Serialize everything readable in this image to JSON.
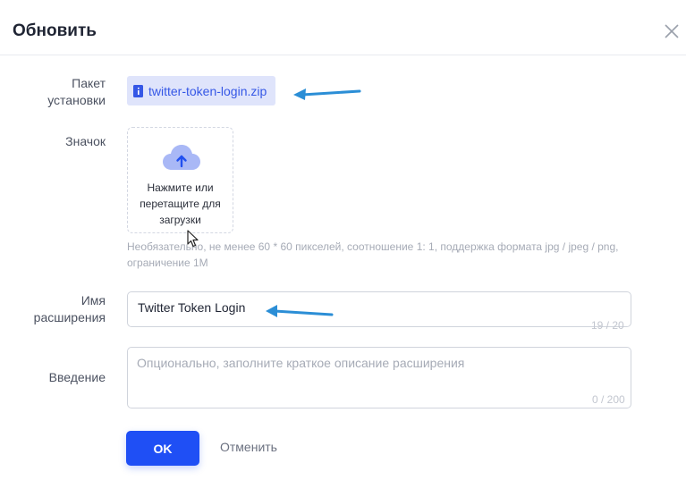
{
  "dialog": {
    "title": "Обновить",
    "close_icon": "close-icon"
  },
  "form": {
    "package_label_line1": "Пакет",
    "package_label_line2": "установки",
    "package_file": "twitter-token-login.zip",
    "icon_label": "Значок",
    "upload_text_line1": "Нажмите или",
    "upload_text_line2": "перетащите для",
    "upload_text_line3": "загрузки",
    "upload_hint_line1": "Необязательно, не менее 60 * 60 пикселей, соотношение 1: 1, поддержка формата jpg / jpeg / png,",
    "upload_hint_line2": "ограничение 1M",
    "name_label_line1": "Имя",
    "name_label_line2": "расширения",
    "name_value": "Twitter Token Login",
    "name_counter": "19 / 20",
    "intro_label": "Введение",
    "intro_placeholder": "Опционально, заполните краткое описание расширения",
    "intro_counter": "0 / 200"
  },
  "buttons": {
    "ok": "OK",
    "cancel": "Отменить"
  },
  "colors": {
    "primary": "#1f4ff5",
    "annotation_arrow": "#2b8ed6",
    "file_chip_bg": "#dfe4fb"
  }
}
